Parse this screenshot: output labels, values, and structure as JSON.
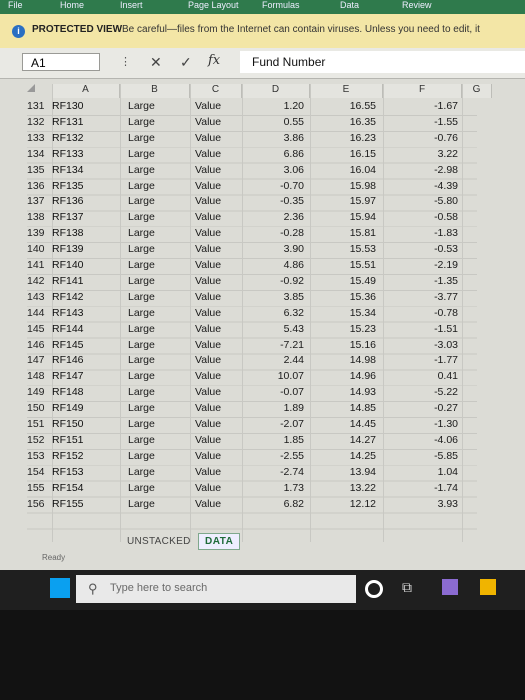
{
  "ribbon": {
    "tabs": [
      "File",
      "Home",
      "Insert",
      "Page Layout",
      "Formulas",
      "Data",
      "Review"
    ]
  },
  "protected_view": {
    "title": "PROTECTED VIEW",
    "message": "Be careful—files from the Internet can contain viruses. Unless you need to edit, it"
  },
  "formula_bar": {
    "name_box": "A1",
    "value": "Fund Number",
    "fx": "fx"
  },
  "columns": [
    "A",
    "B",
    "C",
    "D",
    "E",
    "F",
    "G"
  ],
  "rows": [
    {
      "n": "131",
      "a": "RF130",
      "b": "Large",
      "c": "Value",
      "d": "1.20",
      "e": "16.55",
      "f": "-1.67"
    },
    {
      "n": "132",
      "a": "RF131",
      "b": "Large",
      "c": "Value",
      "d": "0.55",
      "e": "16.35",
      "f": "-1.55"
    },
    {
      "n": "133",
      "a": "RF132",
      "b": "Large",
      "c": "Value",
      "d": "3.86",
      "e": "16.23",
      "f": "-0.76"
    },
    {
      "n": "134",
      "a": "RF133",
      "b": "Large",
      "c": "Value",
      "d": "6.86",
      "e": "16.15",
      "f": "3.22"
    },
    {
      "n": "135",
      "a": "RF134",
      "b": "Large",
      "c": "Value",
      "d": "3.06",
      "e": "16.04",
      "f": "-2.98"
    },
    {
      "n": "136",
      "a": "RF135",
      "b": "Large",
      "c": "Value",
      "d": "-0.70",
      "e": "15.98",
      "f": "-4.39"
    },
    {
      "n": "137",
      "a": "RF136",
      "b": "Large",
      "c": "Value",
      "d": "-0.35",
      "e": "15.97",
      "f": "-5.80"
    },
    {
      "n": "138",
      "a": "RF137",
      "b": "Large",
      "c": "Value",
      "d": "2.36",
      "e": "15.94",
      "f": "-0.58"
    },
    {
      "n": "139",
      "a": "RF138",
      "b": "Large",
      "c": "Value",
      "d": "-0.28",
      "e": "15.81",
      "f": "-1.83"
    },
    {
      "n": "140",
      "a": "RF139",
      "b": "Large",
      "c": "Value",
      "d": "3.90",
      "e": "15.53",
      "f": "-0.53"
    },
    {
      "n": "141",
      "a": "RF140",
      "b": "Large",
      "c": "Value",
      "d": "4.86",
      "e": "15.51",
      "f": "-2.19"
    },
    {
      "n": "142",
      "a": "RF141",
      "b": "Large",
      "c": "Value",
      "d": "-0.92",
      "e": "15.49",
      "f": "-1.35"
    },
    {
      "n": "143",
      "a": "RF142",
      "b": "Large",
      "c": "Value",
      "d": "3.85",
      "e": "15.36",
      "f": "-3.77"
    },
    {
      "n": "144",
      "a": "RF143",
      "b": "Large",
      "c": "Value",
      "d": "6.32",
      "e": "15.34",
      "f": "-0.78"
    },
    {
      "n": "145",
      "a": "RF144",
      "b": "Large",
      "c": "Value",
      "d": "5.43",
      "e": "15.23",
      "f": "-1.51"
    },
    {
      "n": "146",
      "a": "RF145",
      "b": "Large",
      "c": "Value",
      "d": "-7.21",
      "e": "15.16",
      "f": "-3.03"
    },
    {
      "n": "147",
      "a": "RF146",
      "b": "Large",
      "c": "Value",
      "d": "2.44",
      "e": "14.98",
      "f": "-1.77"
    },
    {
      "n": "148",
      "a": "RF147",
      "b": "Large",
      "c": "Value",
      "d": "10.07",
      "e": "14.96",
      "f": "0.41"
    },
    {
      "n": "149",
      "a": "RF148",
      "b": "Large",
      "c": "Value",
      "d": "-0.07",
      "e": "14.93",
      "f": "-5.22"
    },
    {
      "n": "150",
      "a": "RF149",
      "b": "Large",
      "c": "Value",
      "d": "1.89",
      "e": "14.85",
      "f": "-0.27"
    },
    {
      "n": "151",
      "a": "RF150",
      "b": "Large",
      "c": "Value",
      "d": "-2.07",
      "e": "14.45",
      "f": "-1.30"
    },
    {
      "n": "152",
      "a": "RF151",
      "b": "Large",
      "c": "Value",
      "d": "1.85",
      "e": "14.27",
      "f": "-4.06"
    },
    {
      "n": "153",
      "a": "RF152",
      "b": "Large",
      "c": "Value",
      "d": "-2.55",
      "e": "14.25",
      "f": "-5.85"
    },
    {
      "n": "154",
      "a": "RF153",
      "b": "Large",
      "c": "Value",
      "d": "-2.74",
      "e": "13.94",
      "f": "1.04"
    },
    {
      "n": "155",
      "a": "RF154",
      "b": "Large",
      "c": "Value",
      "d": "1.73",
      "e": "13.22",
      "f": "-1.74"
    },
    {
      "n": "156",
      "a": "RF155",
      "b": "Large",
      "c": "Value",
      "d": "6.82",
      "e": "12.12",
      "f": "3.93"
    }
  ],
  "sheet_tabs": [
    "UNSTACKED",
    "DATA"
  ],
  "status": "Ready",
  "taskbar": {
    "search_placeholder": "Type here to search"
  }
}
